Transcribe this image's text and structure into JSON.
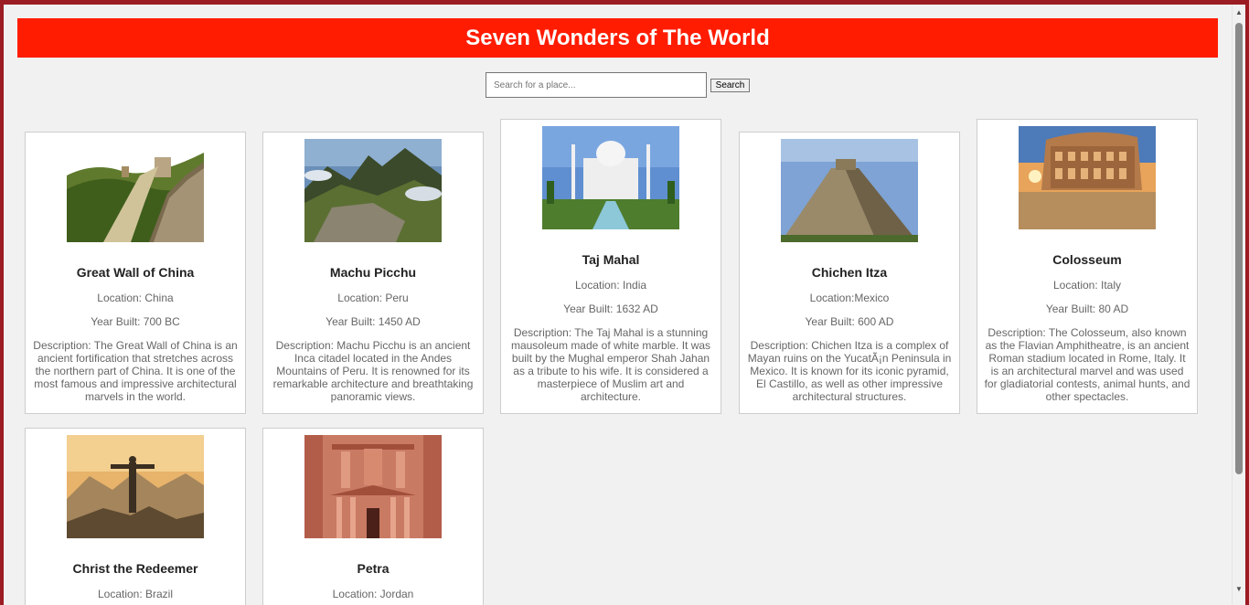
{
  "page": {
    "title": "Seven Wonders of The World"
  },
  "search": {
    "placeholder": "Search for a place...",
    "button_label": "Search"
  },
  "wonders": [
    {
      "name": "Great Wall of China",
      "location": "Location: China",
      "year": "Year Built: 700 BC",
      "description": "Description: The Great Wall of China is an ancient fortification that stretches across the northern part of China. It is one of the most famous and impressive architectural marvels in the world."
    },
    {
      "name": "Machu Picchu",
      "location": "Location: Peru",
      "year": "Year Built: 1450 AD",
      "description": "Description: Machu Picchu is an ancient Inca citadel located in the Andes Mountains of Peru. It is renowned for its remarkable architecture and breathtaking panoramic views."
    },
    {
      "name": "Taj Mahal",
      "location": "Location: India",
      "year": "Year Built: 1632 AD",
      "description": "Description: The Taj Mahal is a stunning mausoleum made of white marble. It was built by the Mughal emperor Shah Jahan as a tribute to his wife. It is considered a masterpiece of Muslim art and architecture."
    },
    {
      "name": "Chichen Itza",
      "location": "Location:Mexico",
      "year": "Year Built: 600 AD",
      "description": "Description: Chichen Itza is a complex of Mayan ruins on the YucatÃ¡n Peninsula in Mexico. It is known for its iconic pyramid, El Castillo, as well as other impressive architectural structures."
    },
    {
      "name": "Colosseum",
      "location": "Location: Italy",
      "year": "Year Built: 80 AD",
      "description": "Description: The Colosseum, also known as the Flavian Amphitheatre, is an ancient Roman stadium located in Rome, Italy. It is an architectural marvel and was used for gladiatorial contests, animal hunts, and other spectacles."
    },
    {
      "name": "Christ the Redeemer",
      "location": "Location: Brazil"
    },
    {
      "name": "Petra",
      "location": "Location: Jordan"
    }
  ],
  "icons": {
    "scroll_up": "scroll-up-arrow-icon",
    "scroll_down": "scroll-down-arrow-icon"
  },
  "colors": {
    "header_bg": "#ff1c00",
    "frame": "#9b1c22",
    "page_bg": "#f1f1f1"
  }
}
